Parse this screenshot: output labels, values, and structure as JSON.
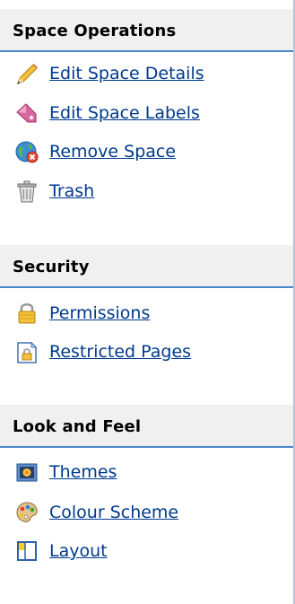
{
  "sections": [
    {
      "title": "Space Operations",
      "items": [
        {
          "label": "Edit Space Details",
          "icon": "pencil-icon"
        },
        {
          "label": "Edit Space Labels",
          "icon": "label-tag-icon"
        },
        {
          "label": "Remove Space",
          "icon": "remove-globe-icon"
        },
        {
          "label": "Trash",
          "icon": "trash-icon"
        }
      ]
    },
    {
      "title": "Security",
      "items": [
        {
          "label": "Permissions",
          "icon": "padlock-icon"
        },
        {
          "label": "Restricted Pages",
          "icon": "restricted-page-icon"
        }
      ]
    },
    {
      "title": "Look and Feel",
      "items": [
        {
          "label": "Themes",
          "icon": "themes-icon"
        },
        {
          "label": "Colour Scheme",
          "icon": "palette-icon"
        },
        {
          "label": "Layout",
          "icon": "layout-icon"
        }
      ]
    }
  ],
  "colors": {
    "link": "#003a8c",
    "header_bg": "#f0f0f0",
    "header_rule": "#4a86c8"
  }
}
